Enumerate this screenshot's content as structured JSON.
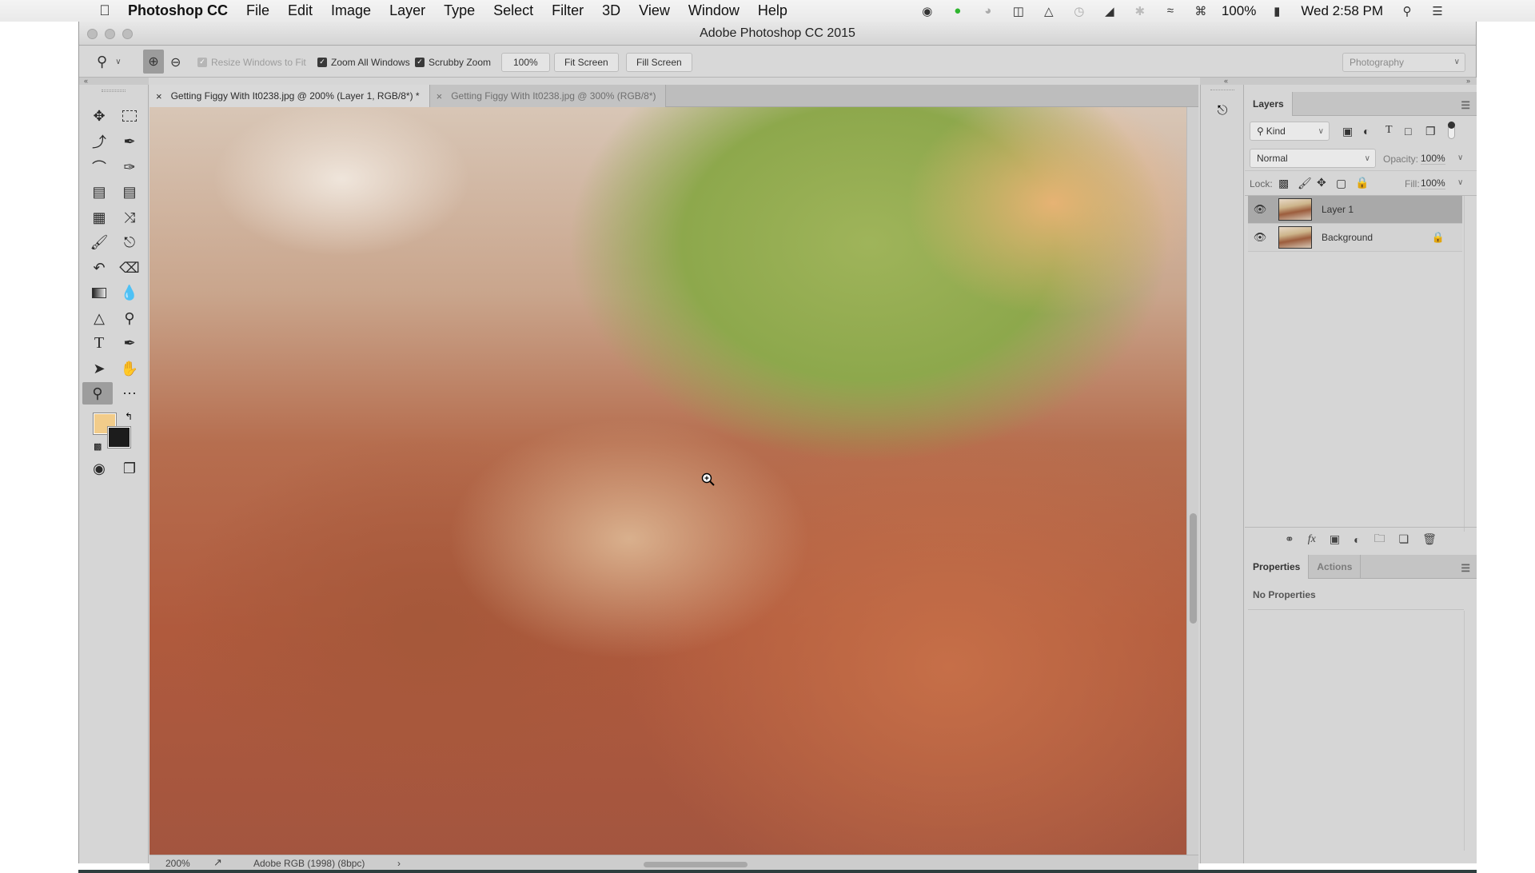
{
  "menubar": {
    "app_name": "Photoshop CC",
    "items": [
      "File",
      "Edit",
      "Image",
      "Layer",
      "Type",
      "Select",
      "Filter",
      "3D",
      "View",
      "Window",
      "Help"
    ],
    "status_icons": [
      "record-icon",
      "wechat-icon",
      "headphones-icon",
      "sidebar-icon",
      "airplay-icon",
      "time-machine-icon",
      "volume-icon",
      "bluetooth-icon",
      "wifi-icon",
      "keyboard-icon"
    ],
    "battery": "100%",
    "clock": "Wed 2:58 PM"
  },
  "window": {
    "title": "Adobe Photoshop CC 2015"
  },
  "options_bar": {
    "resize_windows_label": "Resize Windows to Fit",
    "resize_windows_checked": true,
    "resize_windows_enabled": false,
    "zoom_all_label": "Zoom All Windows",
    "zoom_all_checked": true,
    "scrubby_label": "Scrubby Zoom",
    "scrubby_checked": true,
    "btn_100": "100%",
    "btn_fit": "Fit Screen",
    "btn_fill": "Fill Screen",
    "workspace": "Photography"
  },
  "tabs": [
    {
      "label": "Getting Figgy With It0238.jpg @ 200% (Layer 1, RGB/8*) *",
      "active": true
    },
    {
      "label": "Getting Figgy With It0238.jpg @ 300% (RGB/8*)",
      "active": false
    }
  ],
  "tools": {
    "active": "zoom-tool",
    "foreground_color": "#f2cc8a",
    "background_color": "#1c1c1c"
  },
  "status_bar": {
    "zoom": "200%",
    "profile": "Adobe RGB (1998) (8bpc)"
  },
  "layers_panel": {
    "tab": "Layers",
    "filter_kind": "Kind",
    "blend_mode": "Normal",
    "opacity_label": "Opacity:",
    "opacity": "100%",
    "lock_label": "Lock:",
    "fill_label": "Fill:",
    "fill": "100%",
    "layers": [
      {
        "name": "Layer 1",
        "visible": true,
        "selected": true,
        "locked": false
      },
      {
        "name": "Background",
        "visible": true,
        "selected": false,
        "locked": true
      }
    ]
  },
  "properties_panel": {
    "tabs": [
      "Properties",
      "Actions"
    ],
    "message": "No Properties"
  }
}
